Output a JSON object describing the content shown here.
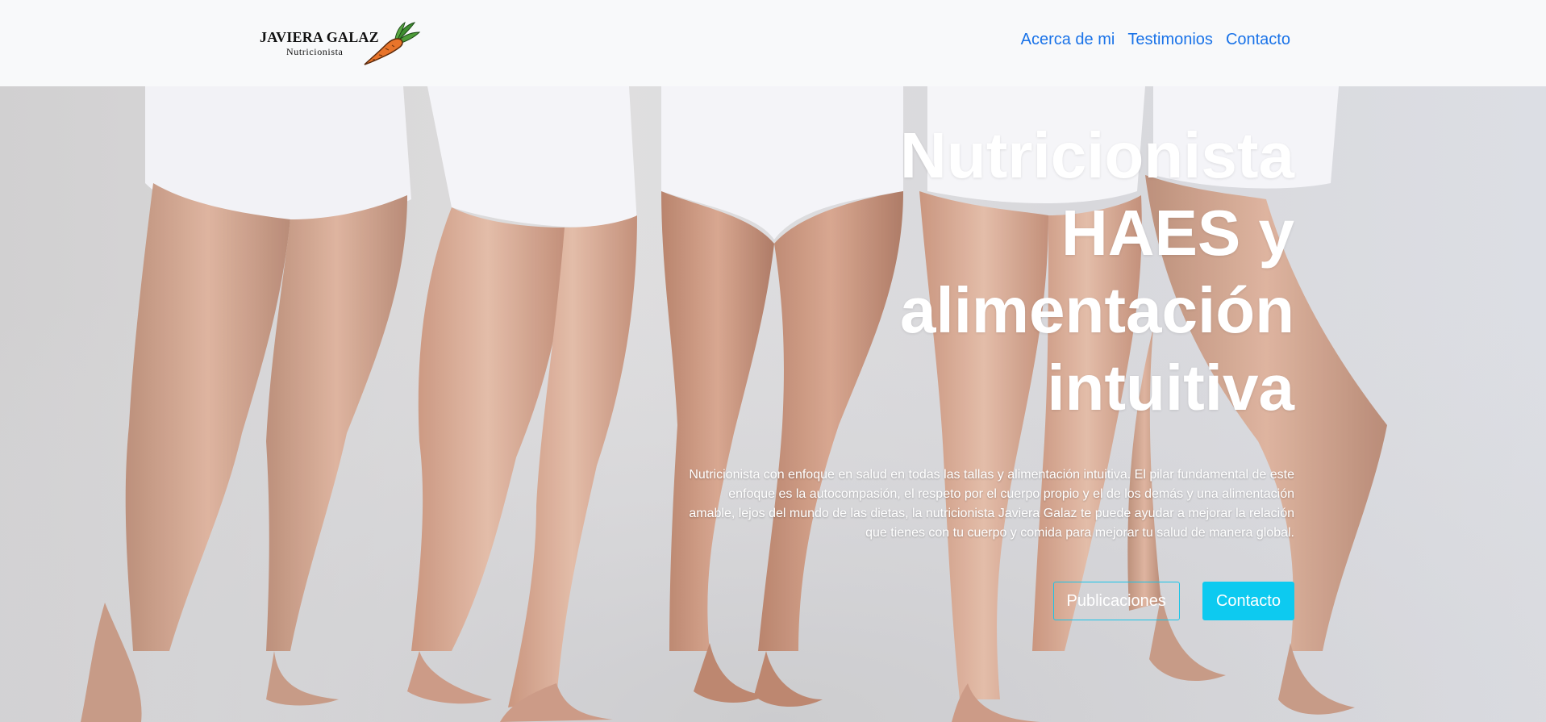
{
  "brand": {
    "name": "JAVIERA GALAZ",
    "subtitle": "Nutricionista",
    "icon": "carrot-icon"
  },
  "nav": {
    "links": [
      {
        "label": "Acerca de mi"
      },
      {
        "label": "Testimonios"
      },
      {
        "label": "Contacto"
      }
    ]
  },
  "hero": {
    "title": "Nutricionista HAES y alimentación intuitiva",
    "description": "Nutricionista con enfoque en salud en todas las tallas y alimentación intuitiva. El pilar fundamental de este enfoque es la autocompasión, el respeto por el cuerpo propio y el de los demás y una alimentación amable, lejos del mundo de las dietas, la nutricionista Javiera Galaz te puede ayudar a mejorar la relación que tienes con tu cuerpo y comida para mejorar tu salud de manera global.",
    "buttons": {
      "secondary": "Publicaciones",
      "primary": "Contacto"
    }
  },
  "colors": {
    "nav_link": "#1a73e8",
    "accent": "#0dcaf0",
    "nav_bg": "#f8f9fa"
  }
}
